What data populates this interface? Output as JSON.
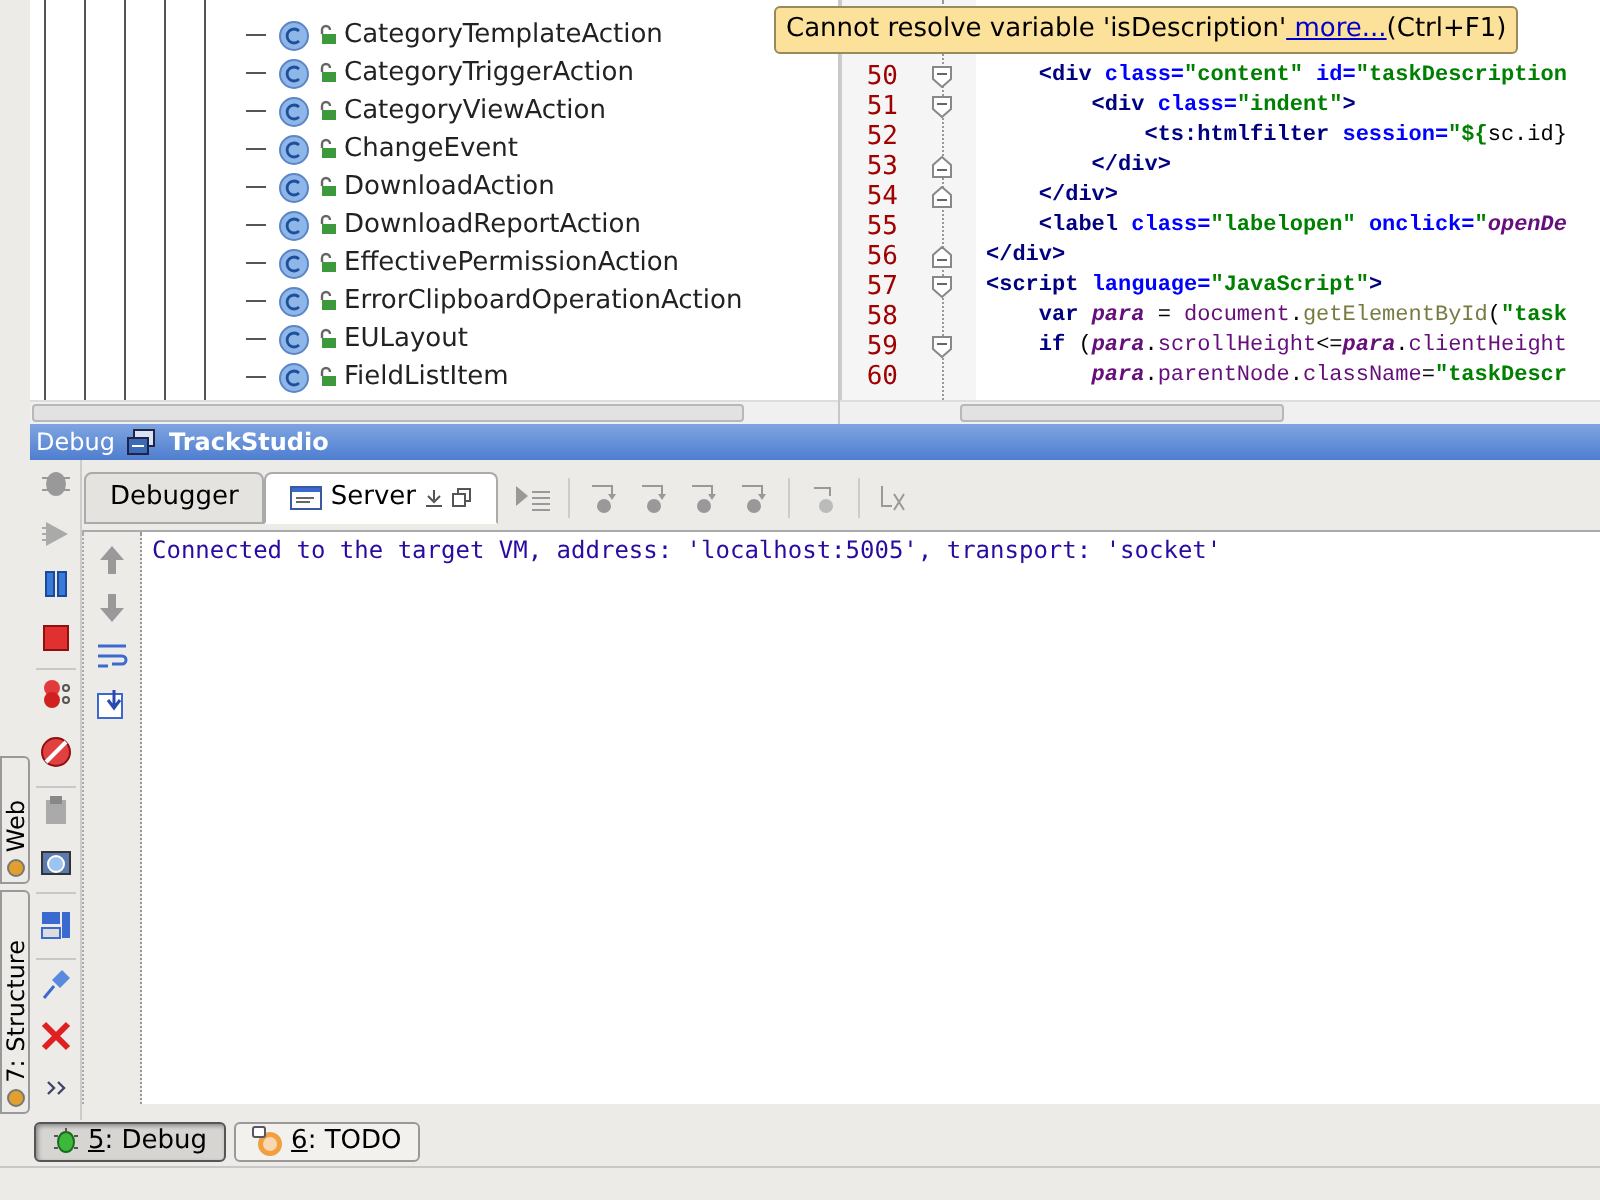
{
  "tree": {
    "items": [
      "CategoryTemplateAction",
      "CategoryTriggerAction",
      "CategoryViewAction",
      "ChangeEvent",
      "DownloadAction",
      "DownloadReportAction",
      "EffectivePermissionAction",
      "ErrorClipboardOperationAction",
      "EULayout",
      "FieldListItem"
    ]
  },
  "editor": {
    "tooltip": {
      "message": "Cannot resolve variable 'isDescription'",
      "link": " more...",
      "shortcut": "(Ctrl+F1)"
    },
    "lines": [
      {
        "number": "50",
        "fold_start": true,
        "fold_end": false,
        "tokens": [
          {
            "kind": "tag",
            "text": "    <div "
          },
          {
            "kind": "attr",
            "text": "class="
          },
          {
            "kind": "str",
            "text": "\"content\" "
          },
          {
            "kind": "attr",
            "text": "id="
          },
          {
            "kind": "str",
            "text": "\"taskDescription"
          }
        ]
      },
      {
        "number": "51",
        "fold_start": true,
        "fold_end": false,
        "tokens": [
          {
            "kind": "tag",
            "text": "        <div "
          },
          {
            "kind": "attr",
            "text": "class="
          },
          {
            "kind": "str",
            "text": "\"indent\""
          },
          {
            "kind": "tag",
            "text": ">"
          }
        ]
      },
      {
        "number": "52",
        "fold_start": false,
        "fold_end": false,
        "tokens": [
          {
            "kind": "tag",
            "text": "            <ts:htmlfilter "
          },
          {
            "kind": "attr",
            "text": "session="
          },
          {
            "kind": "str",
            "text": "\"${"
          },
          {
            "kind": "plain",
            "text": "sc.id}"
          }
        ]
      },
      {
        "number": "53",
        "fold_start": false,
        "fold_end": true,
        "tokens": [
          {
            "kind": "tag",
            "text": "        </div>"
          }
        ]
      },
      {
        "number": "54",
        "fold_start": false,
        "fold_end": true,
        "tokens": [
          {
            "kind": "tag",
            "text": "    </div>"
          }
        ]
      },
      {
        "number": "55",
        "fold_start": false,
        "fold_end": false,
        "tokens": [
          {
            "kind": "tag",
            "text": "    <label "
          },
          {
            "kind": "attr",
            "text": "class="
          },
          {
            "kind": "str",
            "text": "\"labelopen\" "
          },
          {
            "kind": "attr",
            "text": "onclick="
          },
          {
            "kind": "str",
            "text": "\""
          },
          {
            "kind": "ital",
            "text": "openDe"
          }
        ]
      },
      {
        "number": "56",
        "fold_start": false,
        "fold_end": true,
        "tokens": [
          {
            "kind": "tag",
            "text": "</div>"
          }
        ]
      },
      {
        "number": "57",
        "fold_start": true,
        "fold_end": false,
        "tokens": [
          {
            "kind": "tag",
            "text": "<script "
          },
          {
            "kind": "attr",
            "text": "language="
          },
          {
            "kind": "str",
            "text": "\"JavaScript\""
          },
          {
            "kind": "tag",
            "text": ">"
          }
        ]
      },
      {
        "number": "58",
        "fold_start": false,
        "fold_end": false,
        "tokens": [
          {
            "kind": "kw",
            "text": "    var "
          },
          {
            "kind": "ital",
            "text": "para"
          },
          {
            "kind": "plain",
            "text": " = "
          },
          {
            "kind": "member",
            "text": "document"
          },
          {
            "kind": "plain",
            "text": "."
          },
          {
            "kind": "fn",
            "text": "getElementById"
          },
          {
            "kind": "plain",
            "text": "("
          },
          {
            "kind": "str",
            "text": "\"task"
          }
        ]
      },
      {
        "number": "59",
        "fold_start": true,
        "fold_end": false,
        "tokens": [
          {
            "kind": "kw",
            "text": "    if "
          },
          {
            "kind": "plain",
            "text": "("
          },
          {
            "kind": "ital",
            "text": "para"
          },
          {
            "kind": "plain",
            "text": "."
          },
          {
            "kind": "member",
            "text": "scrollHeight"
          },
          {
            "kind": "plain",
            "text": "<="
          },
          {
            "kind": "ital",
            "text": "para"
          },
          {
            "kind": "plain",
            "text": "."
          },
          {
            "kind": "member",
            "text": "clientHeight"
          }
        ]
      },
      {
        "number": "60",
        "fold_start": false,
        "fold_end": false,
        "tokens": [
          {
            "kind": "ital",
            "text": "        para"
          },
          {
            "kind": "plain",
            "text": "."
          },
          {
            "kind": "member",
            "text": "parentNode"
          },
          {
            "kind": "plain",
            "text": "."
          },
          {
            "kind": "member",
            "text": "className"
          },
          {
            "kind": "plain",
            "text": "="
          },
          {
            "kind": "str",
            "text": "\"taskDescr"
          }
        ]
      }
    ]
  },
  "debug": {
    "title": "Debug",
    "config": "TrackStudio",
    "tabs": [
      {
        "label": "Debugger",
        "selected": false
      },
      {
        "label": "Server",
        "selected": true
      }
    ],
    "console": [
      "Connected to the target VM, address: 'localhost:5005', transport: 'socket'"
    ]
  },
  "side_tabs": [
    {
      "label": "Web"
    },
    {
      "label": "7: Structure"
    }
  ],
  "bottom_tabs": [
    {
      "mnemonic": "5",
      "label": ": Debug",
      "selected": true
    },
    {
      "mnemonic": "6",
      "label": ": TODO",
      "selected": false
    }
  ]
}
